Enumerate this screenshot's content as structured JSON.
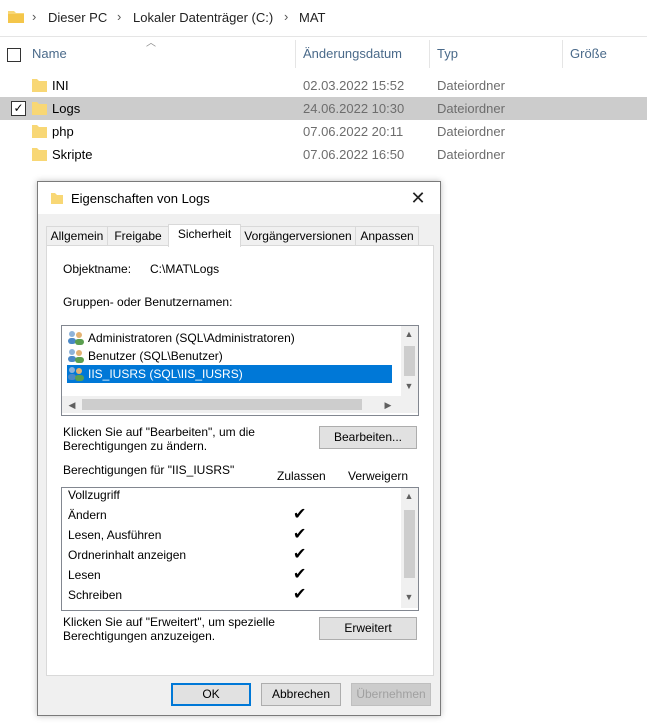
{
  "explorer": {
    "breadcrumb": [
      "Dieser PC",
      "Lokaler Datenträger (C:)",
      "MAT"
    ],
    "columns": {
      "name": "Name",
      "date": "Änderungsdatum",
      "type": "Typ",
      "size": "Größe"
    },
    "rows": [
      {
        "name": "INI",
        "date": "02.03.2022 15:52",
        "type": "Dateiordner",
        "selected": false
      },
      {
        "name": "Logs",
        "date": "24.06.2022 10:30",
        "type": "Dateiordner",
        "selected": true
      },
      {
        "name": "php",
        "date": "07.06.2022 20:11",
        "type": "Dateiordner",
        "selected": false
      },
      {
        "name": "Skripte",
        "date": "07.06.2022 16:50",
        "type": "Dateiordner",
        "selected": false
      }
    ],
    "check_mark": "✓"
  },
  "dialog": {
    "title": "Eigenschaften von Logs",
    "close_glyph": "✕",
    "tabs": [
      "Allgemein",
      "Freigabe",
      "Sicherheit",
      "Vorgängerversionen",
      "Anpassen"
    ],
    "active_tab": "Sicherheit",
    "object_name_label": "Objektname:",
    "object_name_value": "C:\\MAT\\Logs",
    "groups_label": "Gruppen- oder Benutzernamen:",
    "users": [
      {
        "name": "Administratoren (SQL\\Administratoren)",
        "selected": false
      },
      {
        "name": "Benutzer (SQL\\Benutzer)",
        "selected": false
      },
      {
        "name": "IIS_IUSRS (SQL\\IIS_IUSRS)",
        "selected": true
      }
    ],
    "edit_hint_line1": "Klicken Sie auf \"Bearbeiten\", um die",
    "edit_hint_line2": "Berechtigungen zu ändern.",
    "edit_button": "Bearbeiten...",
    "permissions_for": "Berechtigungen für \"IIS_IUSRS\"",
    "col_allow": "Zulassen",
    "col_deny": "Verweigern",
    "permissions": [
      {
        "name": "Vollzugriff",
        "allow": false
      },
      {
        "name": "Ändern",
        "allow": true
      },
      {
        "name": "Lesen, Ausführen",
        "allow": true
      },
      {
        "name": "Ordnerinhalt anzeigen",
        "allow": true
      },
      {
        "name": "Lesen",
        "allow": true
      },
      {
        "name": "Schreiben",
        "allow": true
      }
    ],
    "check_glyph": "✔",
    "advanced_hint_line1": "Klicken Sie auf \"Erweitert\", um spezielle",
    "advanced_hint_line2": "Berechtigungen anzuzeigen.",
    "advanced_button": "Erweitert",
    "ok_button": "OK",
    "cancel_button": "Abbrechen",
    "apply_button": "Übernehmen",
    "scroll_up": "▲",
    "scroll_down": "▼",
    "scroll_left": "◀",
    "scroll_right": "▶"
  },
  "colors": {
    "selection": "#0078d7",
    "row_selected": "#cccccc",
    "folder": "#f8d775"
  }
}
